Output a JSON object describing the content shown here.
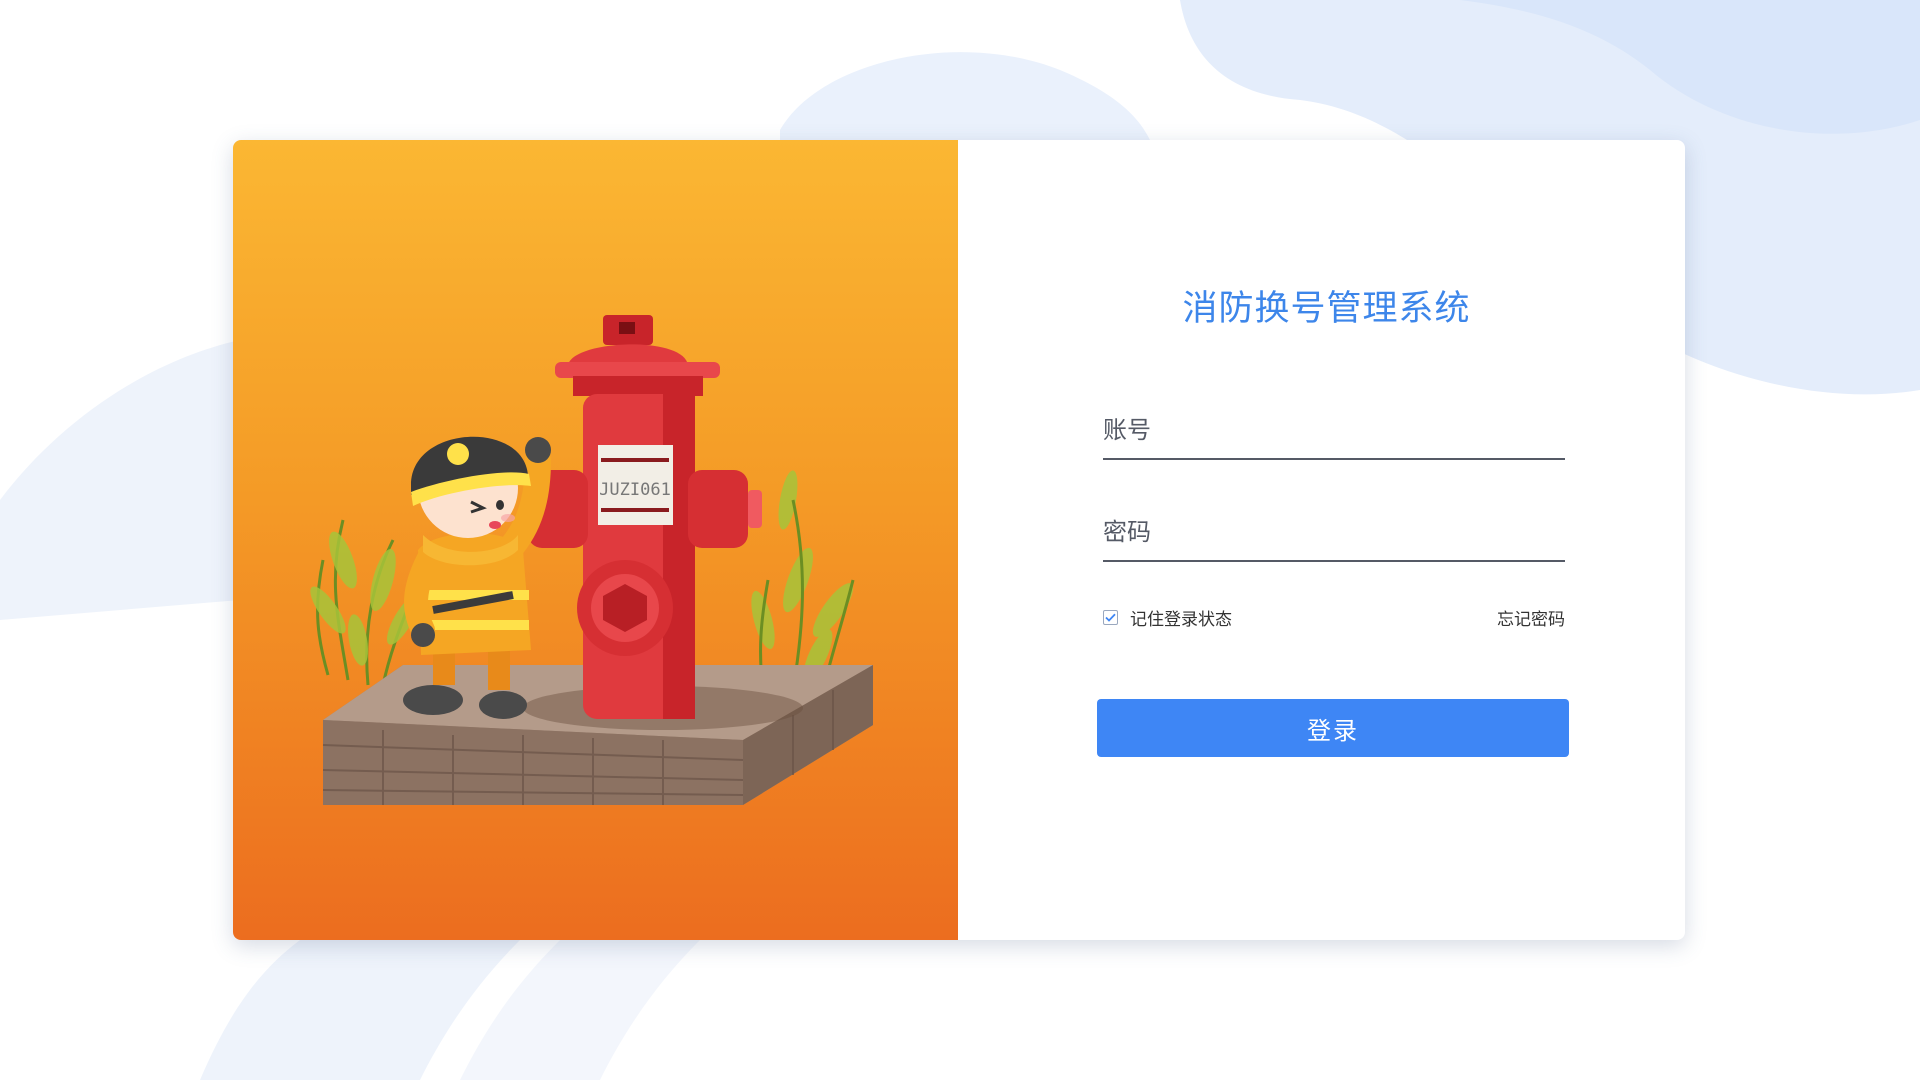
{
  "app": {
    "title": "消防换号管理系统"
  },
  "illustration": {
    "plate_text": "JUZI061",
    "description_icon": "firefighter-hydrant-illustration"
  },
  "form": {
    "account_placeholder": "账号",
    "account_value": "",
    "password_placeholder": "密码",
    "password_value": "",
    "remember_label": "记住登录状态",
    "remember_checked": true,
    "forgot_label": "忘记密码",
    "login_label": "登录"
  },
  "colors": {
    "accent": "#3e86f5",
    "title": "#3d86ea",
    "panel_top": "#fbb733",
    "panel_bottom": "#ec6d1f",
    "hydrant": "#e03a3e"
  }
}
